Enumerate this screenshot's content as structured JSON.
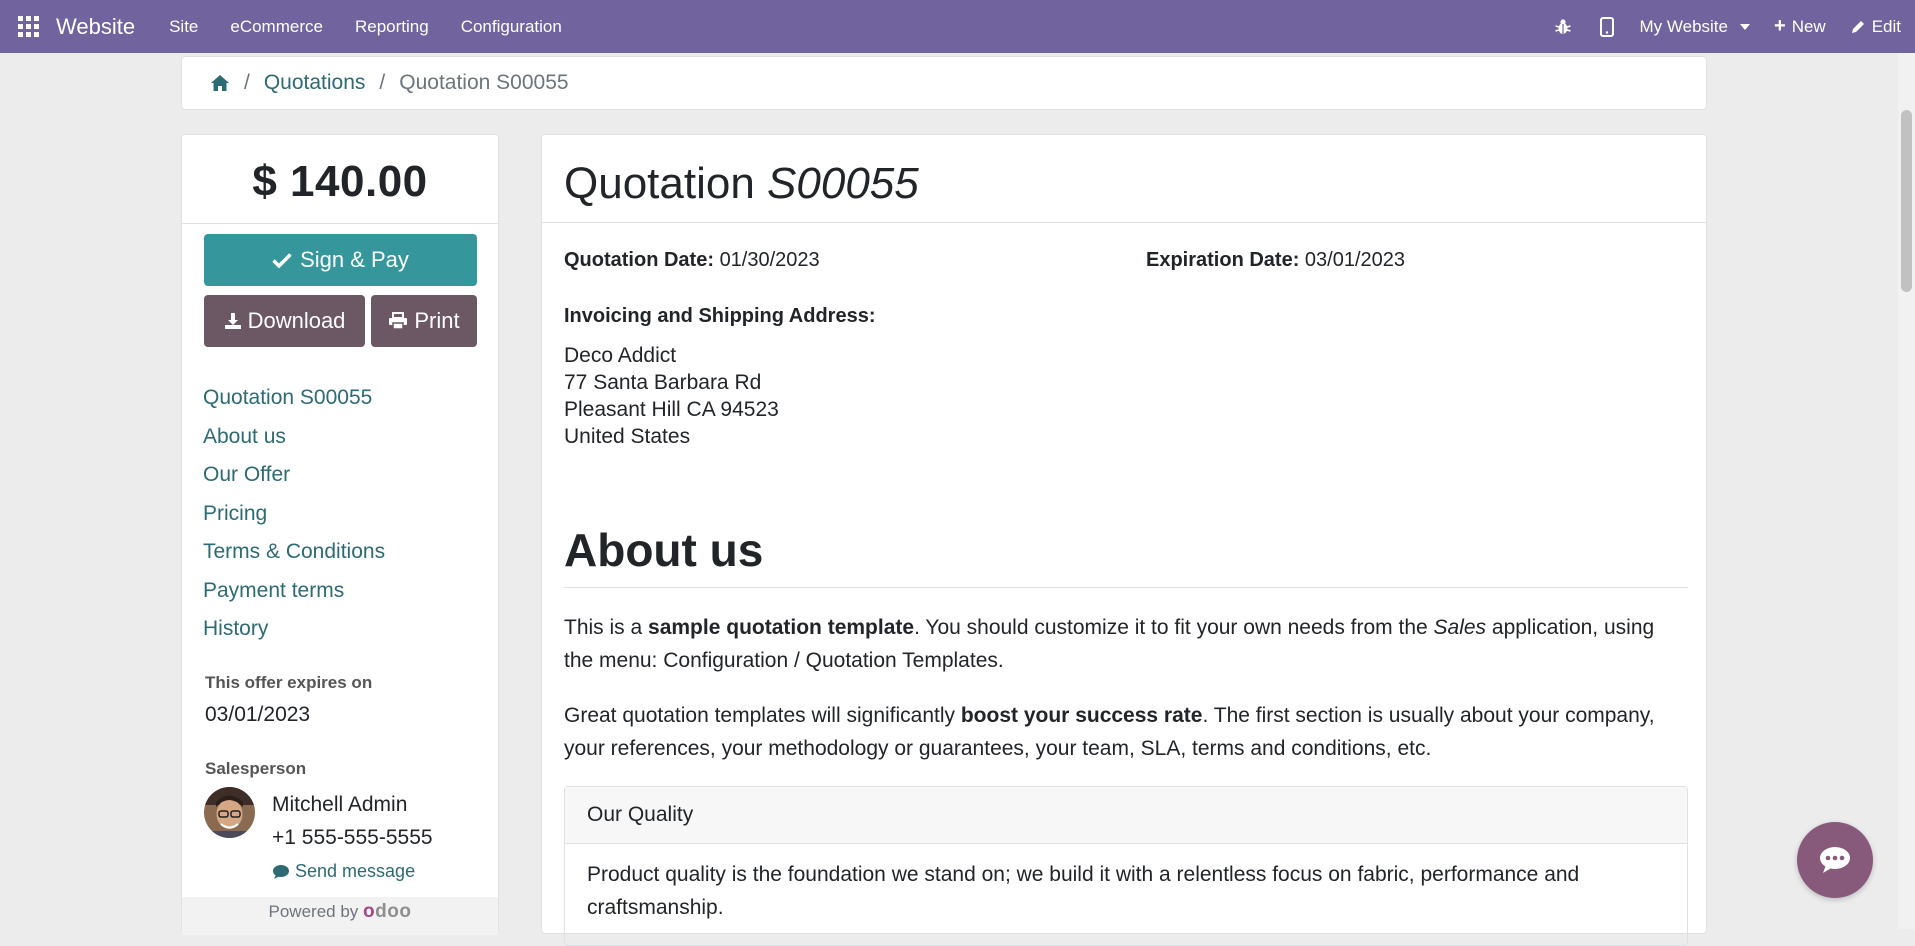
{
  "navbar": {
    "brand": "Website",
    "menu": [
      "Site",
      "eCommerce",
      "Reporting",
      "Configuration"
    ],
    "website_selector": "My Website",
    "new_label": "New",
    "edit_label": "Edit"
  },
  "breadcrumb": {
    "link": "Quotations",
    "current": "Quotation S00055"
  },
  "sidebar": {
    "amount": "$ 140.00",
    "sign_pay_label": "Sign & Pay",
    "download_label": "Download",
    "print_label": "Print",
    "toc": [
      "Quotation S00055",
      "About us",
      "Our Offer",
      "Pricing",
      "Terms & Conditions",
      "Payment terms",
      "History"
    ],
    "expires_label": "This offer expires on",
    "expires_date": "03/01/2023",
    "salesperson_label": "Salesperson",
    "salesperson_name": "Mitchell Admin",
    "salesperson_phone": "+1 555-555-5555",
    "send_message": "Send message",
    "powered_by": "Powered by"
  },
  "main": {
    "title_prefix": "Quotation",
    "title_number": "S00055",
    "quotation_date_label": "Quotation Date:",
    "quotation_date": "01/30/2023",
    "expiration_date_label": "Expiration Date:",
    "expiration_date": "03/01/2023",
    "address_label": "Invoicing and Shipping Address:",
    "address": {
      "name": "Deco Addict",
      "street": "77 Santa Barbara Rd",
      "city": "Pleasant Hill CA 94523",
      "country": "United States"
    },
    "about_heading": "About us",
    "p1": {
      "a": "This is a ",
      "b": "sample quotation template",
      "c": ". You should customize it to fit your own needs from the ",
      "d": "Sales",
      "e": " application, using the menu: Configuration / Quotation Templates."
    },
    "p2": {
      "a": "Great quotation templates will significantly ",
      "b": "boost your success rate",
      "c": ". The first section is usually about your company, your references, your methodology or guarantees, your team, SLA, terms and conditions, etc."
    },
    "quality_heading": "Our Quality",
    "quality_text": "Product quality is the foundation we stand on; we build it with a relentless focus on fabric, performance and craftsmanship."
  },
  "colors": {
    "navbar": "#71639e",
    "primary": "#35979c",
    "secondary": "#6c5764",
    "link": "#2c6b73",
    "chat": "#875a7b"
  }
}
